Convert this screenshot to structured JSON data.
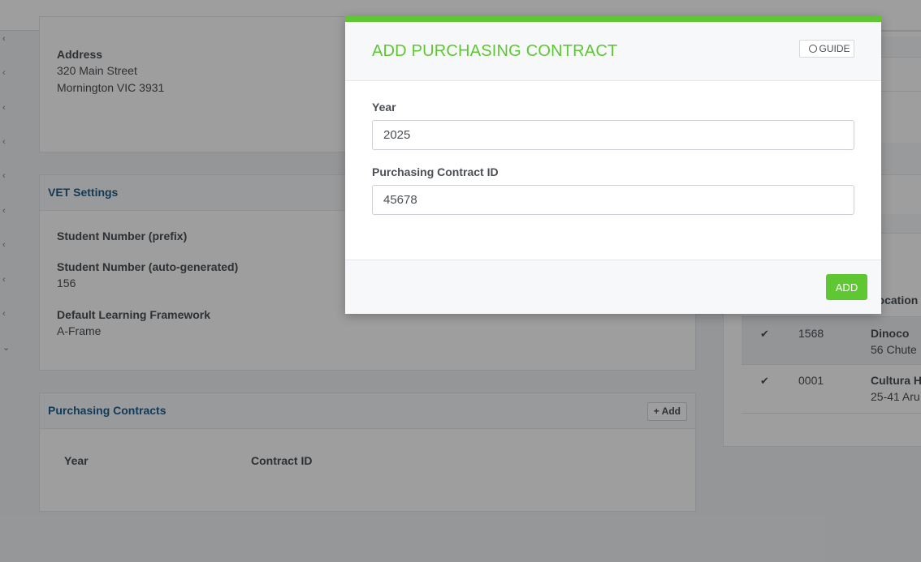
{
  "left_rail": {
    "chevrons": [
      "‹",
      "‹",
      "‹",
      "‹",
      "‹",
      "‹",
      "‹",
      "‹",
      "‹",
      "⌄"
    ]
  },
  "address_panel": {
    "label": "Address",
    "line1": "320 Main Street",
    "line2": "Mornington VIC 3931"
  },
  "vet_settings": {
    "title": "VET Settings",
    "student_prefix_label": "Student Number (prefix)",
    "student_auto_label": "Student Number (auto-generated)",
    "student_auto_value": "156",
    "framework_label": "Default Learning Framework",
    "framework_value": "A-Frame"
  },
  "purchasing_contracts": {
    "title": "Purchasing Contracts",
    "add_label": "+ Add",
    "columns": [
      "Year",
      "Contract ID"
    ]
  },
  "locations_panel": {
    "column_header": "Location",
    "rows": [
      {
        "check": "✔",
        "id": "1568",
        "name": "Dinoco",
        "address": "56 Chute"
      },
      {
        "check": "✔",
        "id": "0001",
        "name": "Cultura H",
        "address": "25-41 Aru"
      }
    ]
  },
  "modal": {
    "title": "ADD PURCHASING CONTRACT",
    "guide_label": "GUIDE",
    "year_label": "Year",
    "year_value": "2025",
    "contract_id_label": "Purchasing Contract ID",
    "contract_id_value": "45678",
    "add_button": "ADD"
  },
  "colors": {
    "accent": "#5ec732",
    "link": "#1f5e8c"
  }
}
